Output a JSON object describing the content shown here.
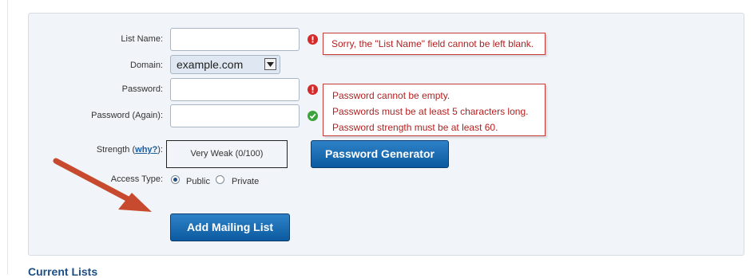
{
  "form": {
    "list_name_label": "List Name:",
    "domain_label": "Domain:",
    "domain_value": "example.com",
    "password_label": "Password:",
    "password_again_label": "Password (Again):",
    "strength_label_prefix": "Strength (",
    "strength_link": "why?",
    "strength_label_suffix": "):",
    "strength_value": "Very Weak (0/100)",
    "access_type_label": "Access Type:",
    "access_options": [
      {
        "label": "Public",
        "selected": true
      },
      {
        "label": "Private",
        "selected": false
      }
    ],
    "list_name_value": "",
    "password_value": "",
    "password_again_value": ""
  },
  "errors": {
    "list_name": "Sorry, the \"List Name\" field cannot be left blank.",
    "password": [
      "Password cannot be empty.",
      "Passwords must be at least 5 characters long.",
      "Password strength must be at least 60."
    ]
  },
  "buttons": {
    "password_generator": "Password Generator",
    "add_mailing_list": "Add Mailing List"
  },
  "sections": {
    "current_lists": "Current Lists"
  },
  "colors": {
    "panel_bg": "#f1f4f8",
    "error_red": "#c63a3a",
    "ok_green": "#3ba33b",
    "button_blue": "#0b5a9f",
    "annotation_arrow": "#c74a2e"
  }
}
